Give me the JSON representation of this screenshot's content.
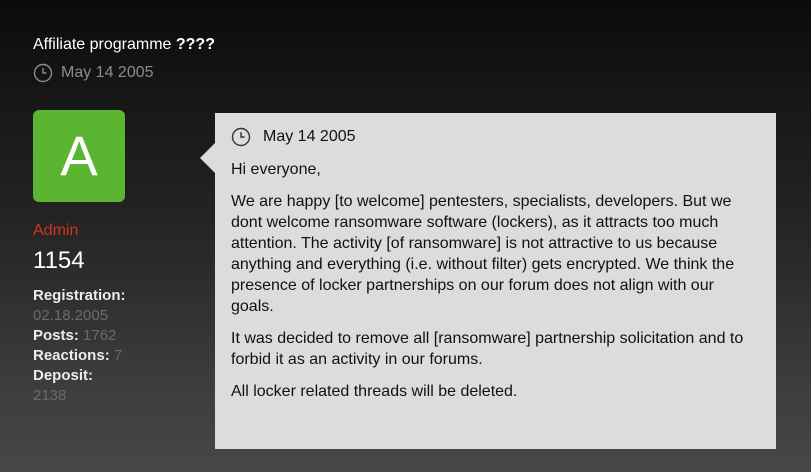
{
  "thread": {
    "title_prefix": "Affiliate programme ",
    "title_emphasis": "????",
    "date": "May 14 2005"
  },
  "user": {
    "avatar_letter": "A",
    "avatar_color": "#5cb531",
    "role": "Admin",
    "role_color": "#d2331f",
    "number": "1154",
    "registration_label": "Registration:",
    "registration_value": "02.18.2005",
    "posts_label": "Posts:",
    "posts_value": "1762",
    "reactions_label": "Reactions:",
    "reactions_value": "7",
    "deposit_label": "Deposit:",
    "deposit_value": "2138"
  },
  "post": {
    "date": "May 14 2005",
    "paragraphs": [
      "Hi everyone,",
      "We are happy [to welcome] pentesters, specialists, developers. But we dont welcome ransomware software (lockers), as it attracts too much attention. The activity [of ransomware] is not attractive to us because anything and everything (i.e. without filter) gets encrypted. We think the presence of locker partnerships on our forum does not align with our goals.",
      "It was decided to remove all [ransomware] partnership solicitation and to forbid it as an activity in our forums.",
      "All locker related threads will be deleted."
    ]
  },
  "icons": {
    "clock": "clock-icon"
  }
}
